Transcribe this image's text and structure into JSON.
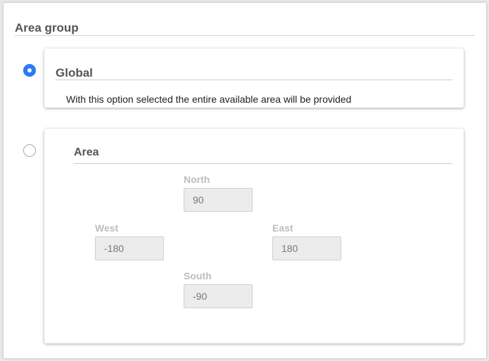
{
  "area_group": {
    "title": "Area group",
    "options": {
      "global": {
        "title": "Global",
        "description": "With this option selected the entire available area will be provided",
        "selected": true
      },
      "area": {
        "title": "Area",
        "selected": false,
        "fields": {
          "north": {
            "label": "North",
            "value": "90"
          },
          "west": {
            "label": "West",
            "value": "-180"
          },
          "east": {
            "label": "East",
            "value": "180"
          },
          "south": {
            "label": "South",
            "value": "-90"
          }
        }
      }
    }
  },
  "colors": {
    "radio_selected": "#2b7bf7",
    "disabled_label": "#bdbdbd",
    "disabled_input_bg": "#ececec"
  }
}
